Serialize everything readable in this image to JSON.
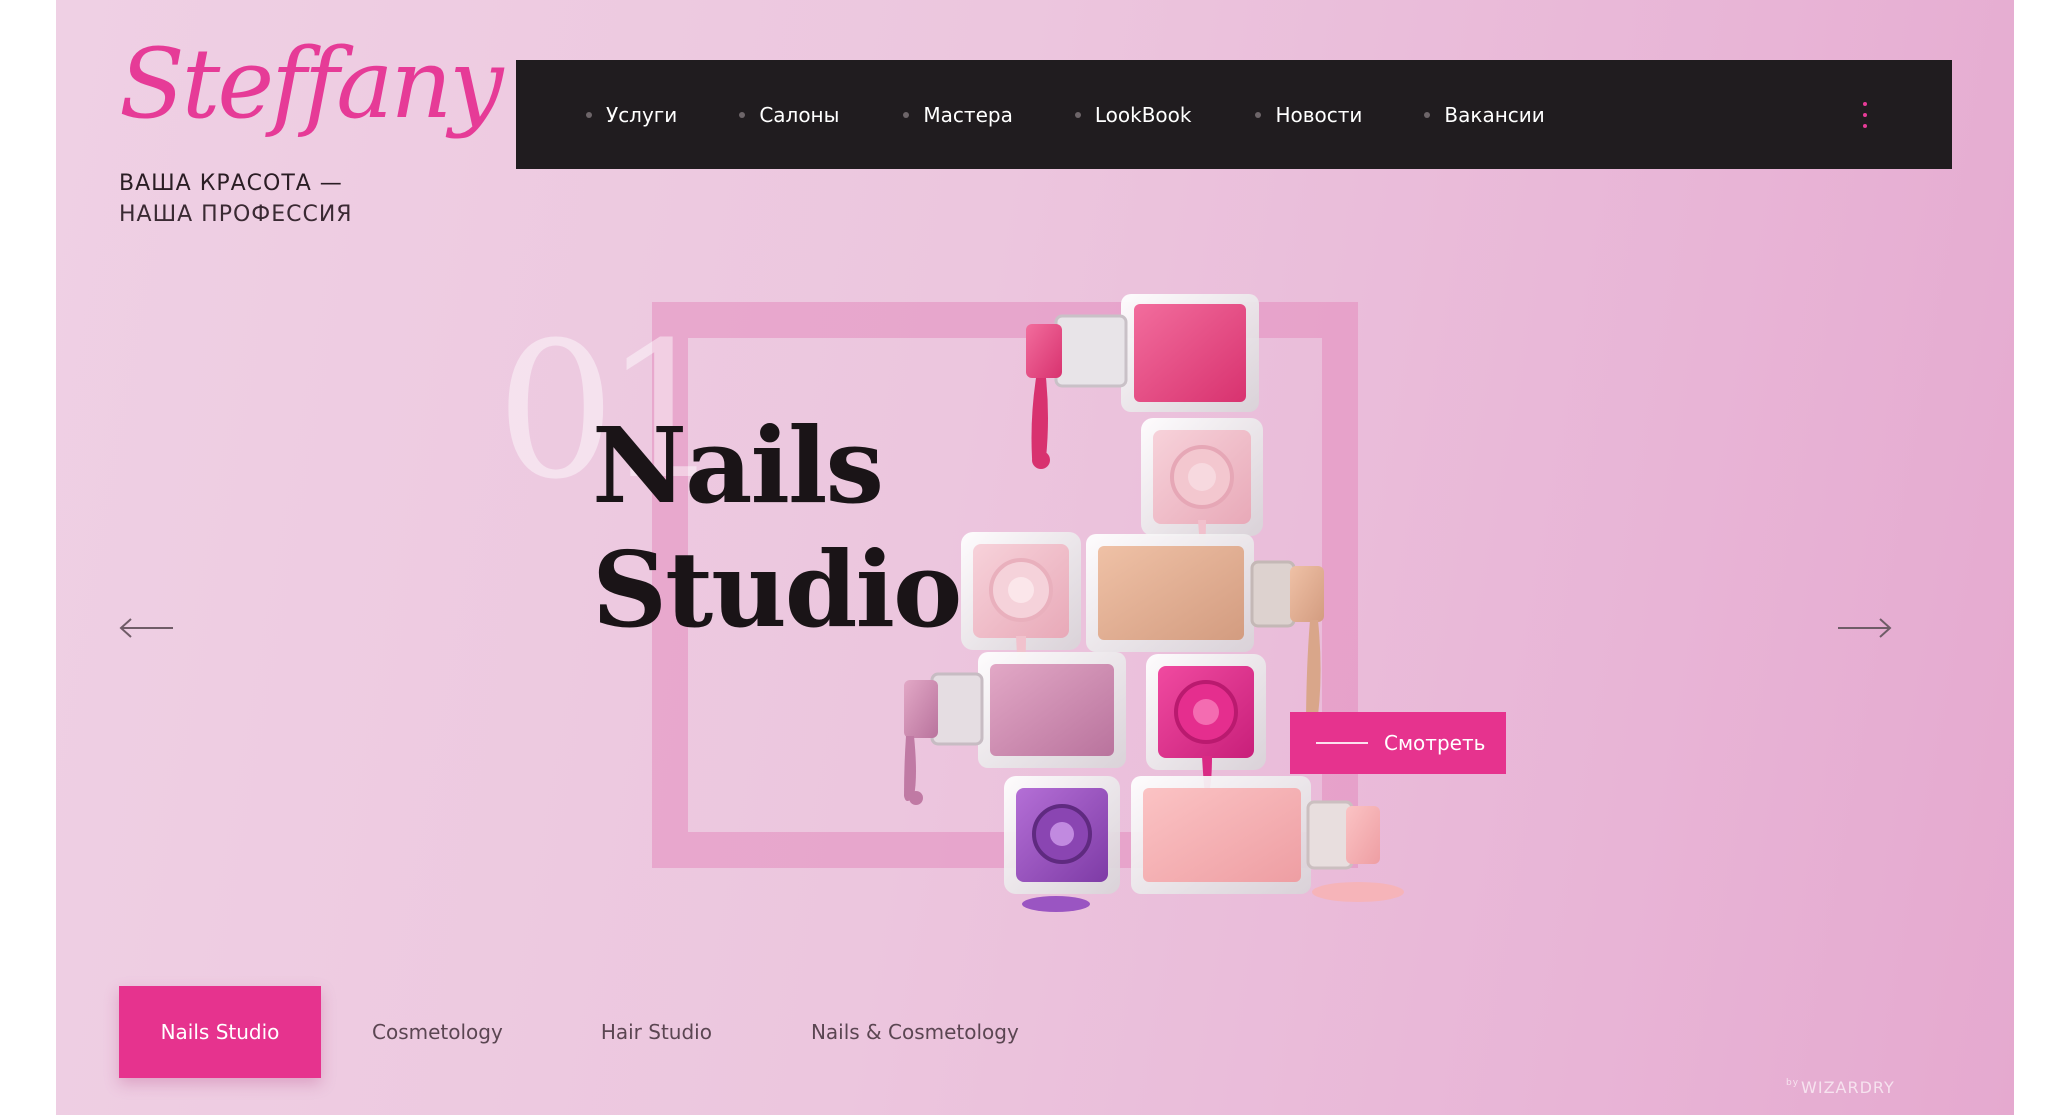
{
  "brand": {
    "logo_text": "Steffany",
    "tagline_line1": "ВАША КРАСОТА —",
    "tagline_line2": "НАША ПРОФЕССИЯ",
    "accent_color": "#e6338e"
  },
  "nav": {
    "items": [
      {
        "label": "Услуги"
      },
      {
        "label": "Салоны"
      },
      {
        "label": "Мастера"
      },
      {
        "label": "LookBook"
      },
      {
        "label": "Новости"
      },
      {
        "label": "Вакансии"
      }
    ],
    "menu_icon": "vertical-dots-icon"
  },
  "hero": {
    "slide_number": "01",
    "title_line1": "Nails",
    "title_line2": "Studio",
    "cta_label": "Смотреть",
    "prev_icon": "arrow-left-icon",
    "next_icon": "arrow-right-icon"
  },
  "tabs": {
    "items": [
      {
        "label": "Nails Studio",
        "active": true
      },
      {
        "label": "Cosmetology",
        "active": false
      },
      {
        "label": "Hair Studio",
        "active": false
      },
      {
        "label": "Nails & Cosmetology",
        "active": false
      }
    ]
  },
  "footer": {
    "credit_prefix": "by",
    "credit_name": "WIZARDRY"
  }
}
